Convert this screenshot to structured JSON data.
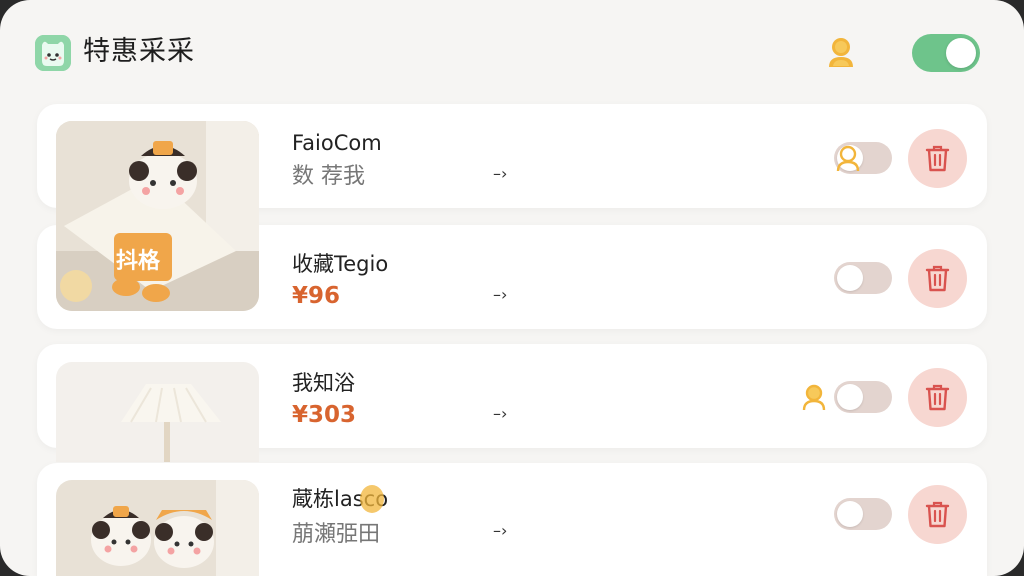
{
  "app": {
    "title": "特惠采采",
    "logo_icon": "logo-face-icon",
    "user_icon": "user-icon",
    "main_toggle_on": true
  },
  "colors": {
    "accent_green": "#6ec48b",
    "price_orange": "#d8642f",
    "trash_bg": "#f7d7d1",
    "trash_icon": "#d9534f",
    "user_yellow": "#f2b53b"
  },
  "items": [
    {
      "name": "FaioCom",
      "subtitle": "数 荐我",
      "arrow": "–›",
      "toggle_on": false
    },
    {
      "name": "收藏Tegio",
      "price": "¥96",
      "arrow": "–›",
      "toggle_on": false
    },
    {
      "name": "我知浴",
      "price": "¥303",
      "arrow": "–›",
      "toggle_on": false
    },
    {
      "name": "蔵栋lasco",
      "subtitle": "萠瀬弫田",
      "arrow": "–›",
      "toggle_on": false
    }
  ],
  "product_tag": "抖格"
}
